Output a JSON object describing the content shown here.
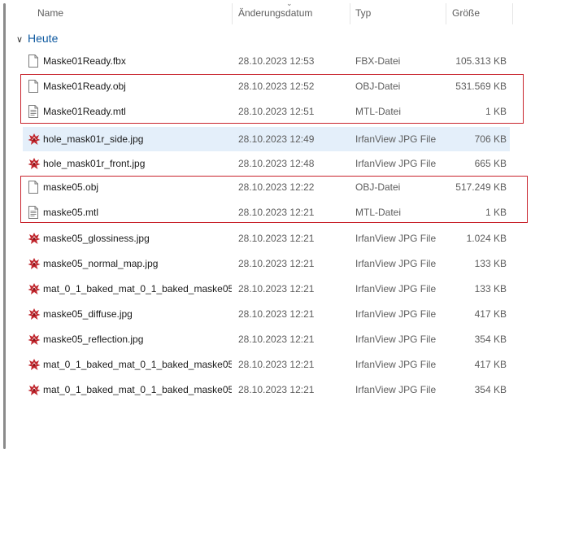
{
  "columns": {
    "name": "Name",
    "date": "Änderungsdatum",
    "type": "Typ",
    "size": "Größe"
  },
  "group": {
    "label": "Heute",
    "chevron_icon": "chevron-down-icon"
  },
  "colors": {
    "accent": "#0f5aa0",
    "highlight_border": "#c8232c",
    "selected_row": "#e4effa"
  },
  "files": [
    {
      "name": "Maske01Ready.fbx",
      "date": "28.10.2023 12:53",
      "type": "FBX-Datei",
      "size": "105.313 KB",
      "icon": "blank-file-icon"
    },
    {
      "name": "Maske01Ready.obj",
      "date": "28.10.2023 12:52",
      "type": "OBJ-Datei",
      "size": "531.569 KB",
      "icon": "blank-file-icon"
    },
    {
      "name": "Maske01Ready.mtl",
      "date": "28.10.2023 12:51",
      "type": "MTL-Datei",
      "size": "1 KB",
      "icon": "text-file-icon"
    },
    {
      "name": "hole_mask01r_side.jpg",
      "date": "28.10.2023 12:49",
      "type": "IrfanView JPG File",
      "size": "706 KB",
      "icon": "irfanview-icon",
      "selected": true
    },
    {
      "name": "hole_mask01r_front.jpg",
      "date": "28.10.2023 12:48",
      "type": "IrfanView JPG File",
      "size": "665 KB",
      "icon": "irfanview-icon"
    },
    {
      "name": "maske05.obj",
      "date": "28.10.2023 12:22",
      "type": "OBJ-Datei",
      "size": "517.249 KB",
      "icon": "blank-file-icon"
    },
    {
      "name": "maske05.mtl",
      "date": "28.10.2023 12:21",
      "type": "MTL-Datei",
      "size": "1 KB",
      "icon": "text-file-icon"
    },
    {
      "name": "maske05_glossiness.jpg",
      "date": "28.10.2023 12:21",
      "type": "IrfanView JPG File",
      "size": "1.024 KB",
      "icon": "irfanview-icon"
    },
    {
      "name": "maske05_normal_map.jpg",
      "date": "28.10.2023 12:21",
      "type": "IrfanView JPG File",
      "size": "133 KB",
      "icon": "irfanview-icon"
    },
    {
      "name": "mat_0_1_baked_mat_0_1_baked_maske05...",
      "date": "28.10.2023 12:21",
      "type": "IrfanView JPG File",
      "size": "133 KB",
      "icon": "irfanview-icon"
    },
    {
      "name": "maske05_diffuse.jpg",
      "date": "28.10.2023 12:21",
      "type": "IrfanView JPG File",
      "size": "417 KB",
      "icon": "irfanview-icon"
    },
    {
      "name": "maske05_reflection.jpg",
      "date": "28.10.2023 12:21",
      "type": "IrfanView JPG File",
      "size": "354 KB",
      "icon": "irfanview-icon"
    },
    {
      "name": "mat_0_1_baked_mat_0_1_baked_maske05...",
      "date": "28.10.2023 12:21",
      "type": "IrfanView JPG File",
      "size": "417 KB",
      "icon": "irfanview-icon"
    },
    {
      "name": "mat_0_1_baked_mat_0_1_baked_maske05...",
      "date": "28.10.2023 12:21",
      "type": "IrfanView JPG File",
      "size": "354 KB",
      "icon": "irfanview-icon"
    }
  ]
}
